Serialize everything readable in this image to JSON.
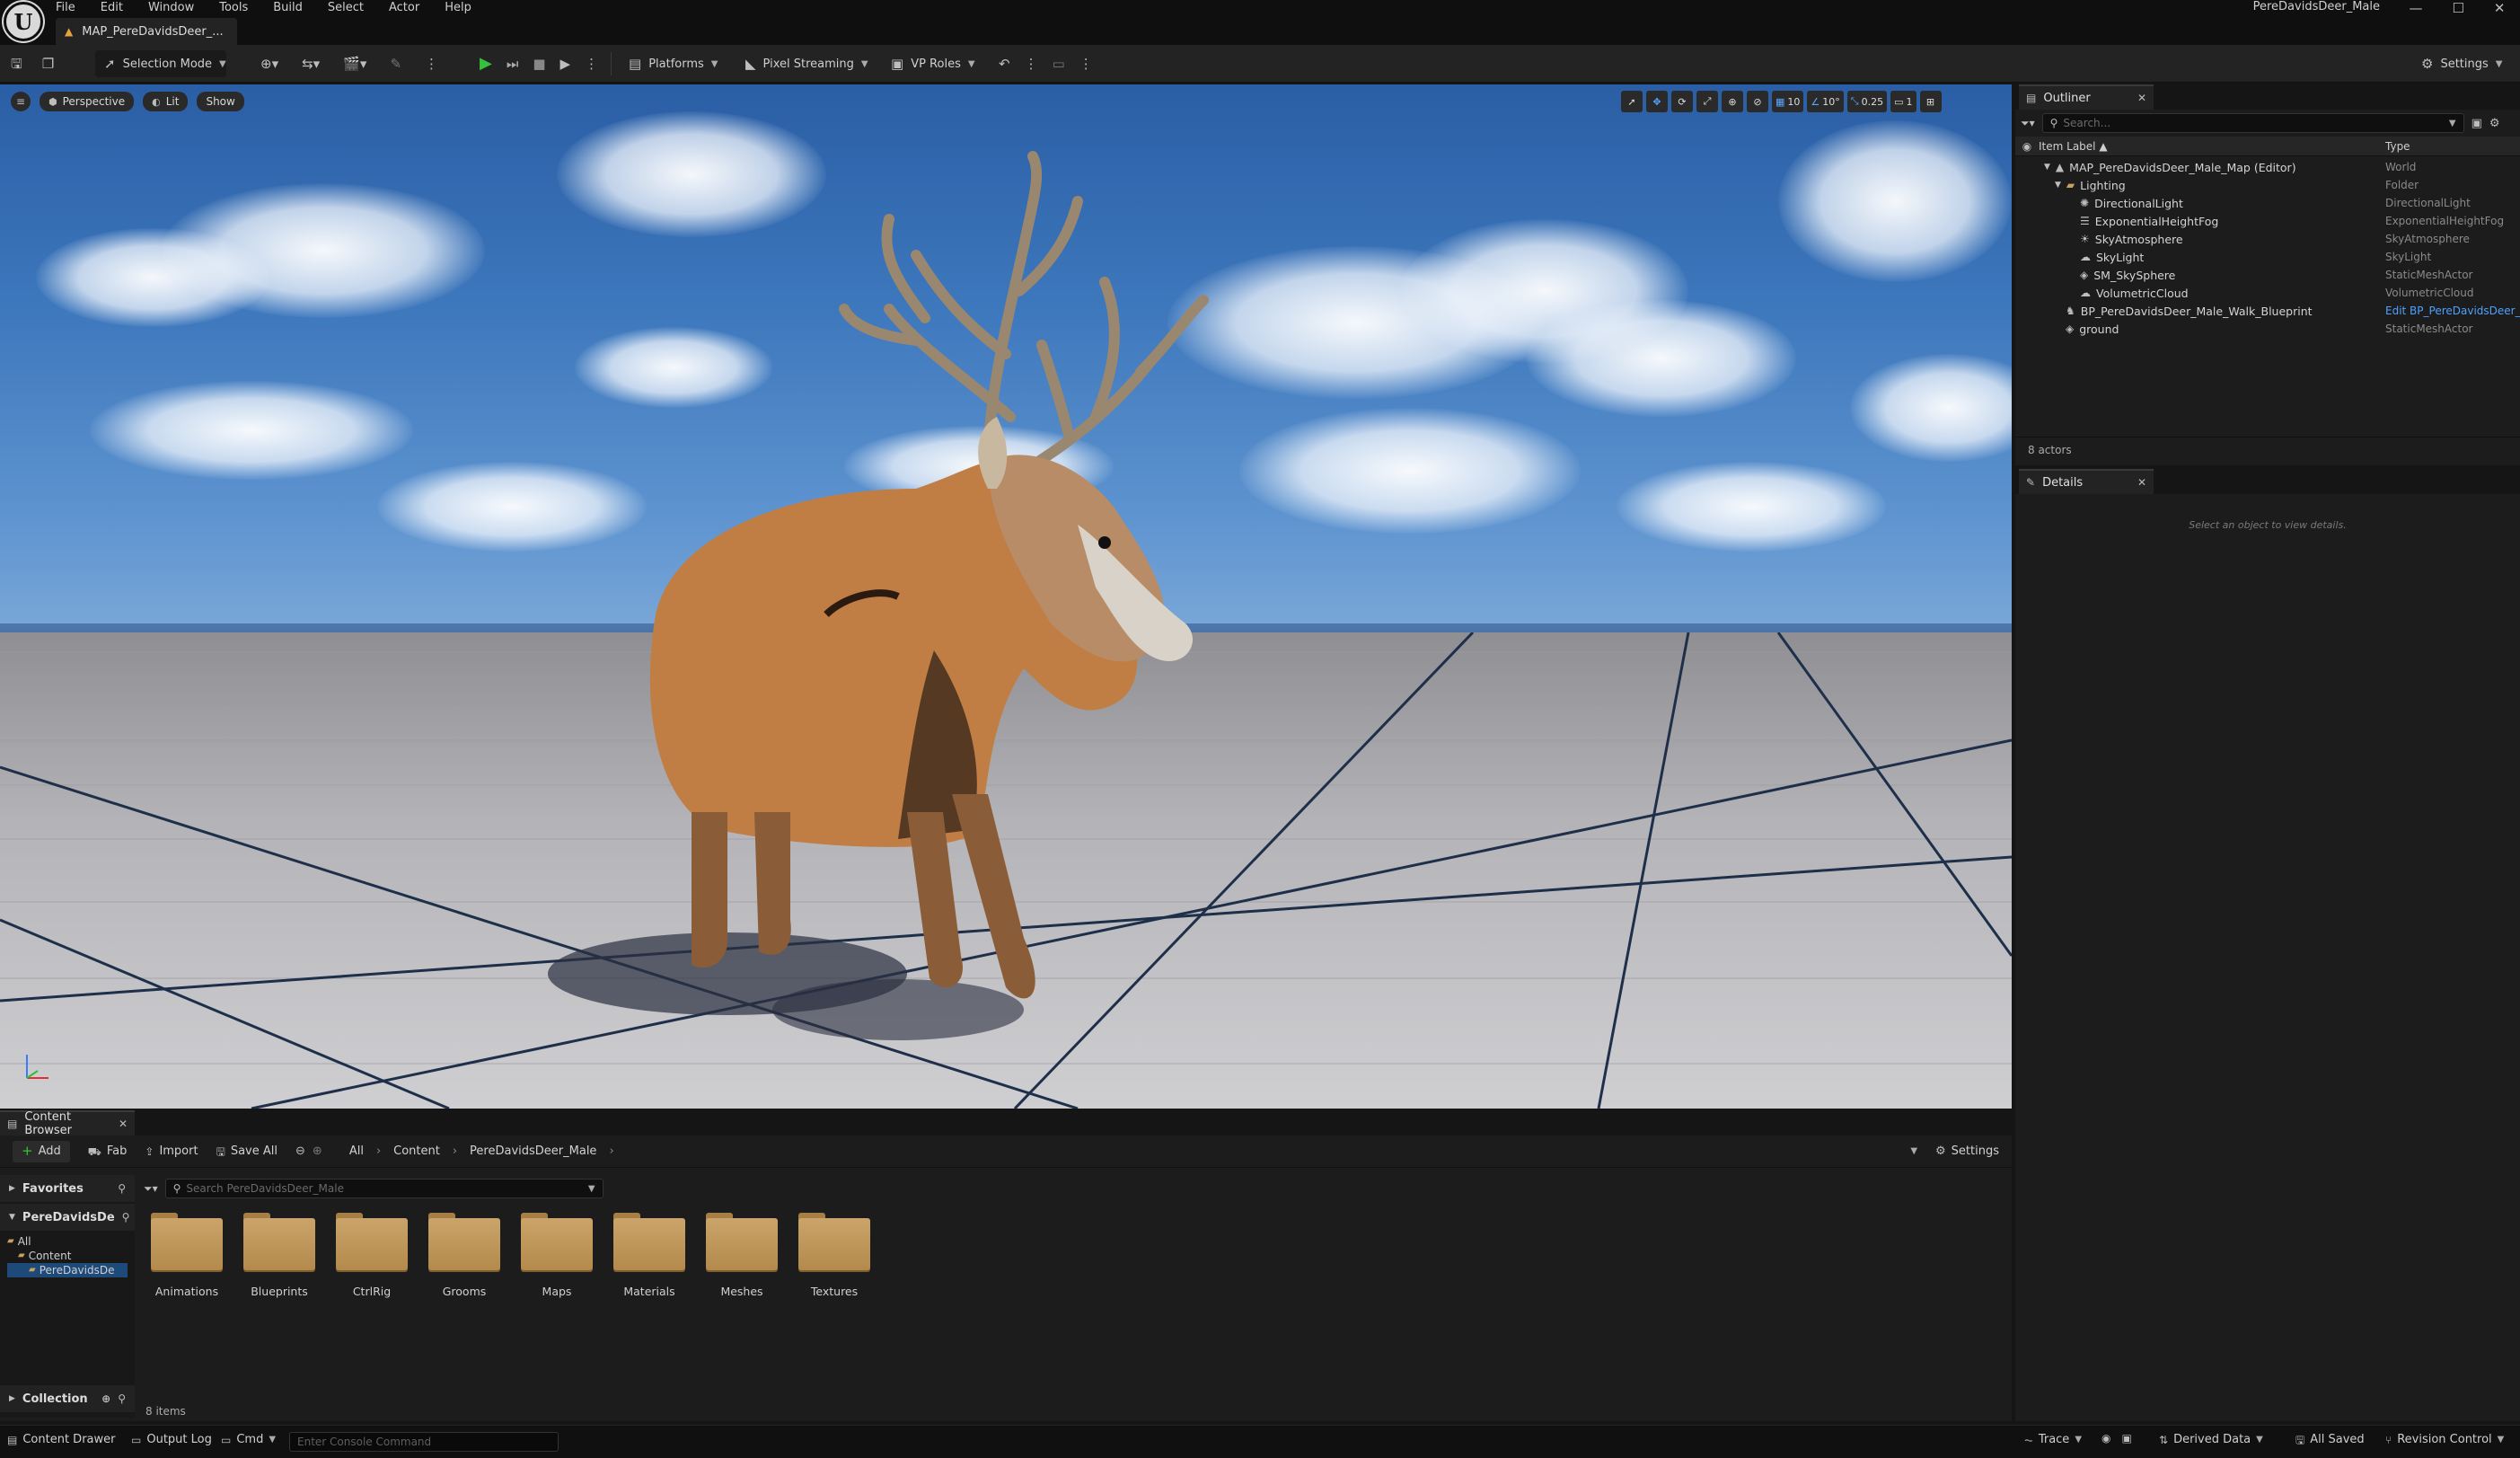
{
  "menu": [
    "File",
    "Edit",
    "Window",
    "Tools",
    "Build",
    "Select",
    "Actor",
    "Help"
  ],
  "document_tab": {
    "label": "MAP_PereDavidsDeer_..."
  },
  "project_name": "PereDavidsDeer_Male",
  "toolbar": {
    "selection_mode": "Selection Mode",
    "platforms": "Platforms",
    "pixel_streaming": "Pixel Streaming",
    "vp_roles": "VP Roles",
    "settings": "Settings"
  },
  "viewport": {
    "perspective": "Perspective",
    "lit": "Lit",
    "show": "Show",
    "grid_snap": "10",
    "rotation_snap": "10°",
    "scale_snap": "0.25",
    "camera_speed": "1"
  },
  "outliner": {
    "tab_label": "Outliner",
    "search_placeholder": "Search...",
    "col_label": "Item Label ▲",
    "col_type": "Type",
    "rows": [
      {
        "label": "MAP_PereDavidsDeer_Male_Map (Editor)",
        "type": "World"
      },
      {
        "label": "Lighting",
        "type": "Folder"
      },
      {
        "label": "DirectionalLight",
        "type": "DirectionalLight"
      },
      {
        "label": "ExponentialHeightFog",
        "type": "ExponentialHeightFog"
      },
      {
        "label": "SkyAtmosphere",
        "type": "SkyAtmosphere"
      },
      {
        "label": "SkyLight",
        "type": "SkyLight"
      },
      {
        "label": "SM_SkySphere",
        "type": "StaticMeshActor"
      },
      {
        "label": "VolumetricCloud",
        "type": "VolumetricCloud"
      },
      {
        "label": "BP_PereDavidsDeer_Male_Walk_Blueprint",
        "type": "Edit BP_PereDavidsDeer_"
      },
      {
        "label": "ground",
        "type": "StaticMeshActor"
      }
    ],
    "footer": "8 actors"
  },
  "details": {
    "tab_label": "Details",
    "hint": "Select an object to view details."
  },
  "content_browser": {
    "tab_label": "Content Browser",
    "add": "Add",
    "fab": "Fab",
    "import": "Import",
    "save_all": "Save All",
    "breadcrumb": [
      "All",
      "Content",
      "PereDavidsDeer_Male"
    ],
    "settings": "Settings",
    "search_placeholder": "Search PereDavidsDeer_Male",
    "favorites": "Favorites",
    "project_folder": "PereDavidsDe",
    "tree": [
      "All",
      "Content",
      "PereDavidsDe"
    ],
    "collection": "Collection",
    "folders": [
      "Animations",
      "Blueprints",
      "CtrlRig",
      "Grooms",
      "Maps",
      "Materials",
      "Meshes",
      "Textures"
    ],
    "item_count": "8 items"
  },
  "statusbar": {
    "content_drawer": "Content Drawer",
    "output_log": "Output Log",
    "cmd": "Cmd",
    "console_placeholder": "Enter Console Command",
    "trace": "Trace",
    "derived_data": "Derived Data",
    "all_saved": "All Saved",
    "revision_control": "Revision Control"
  }
}
